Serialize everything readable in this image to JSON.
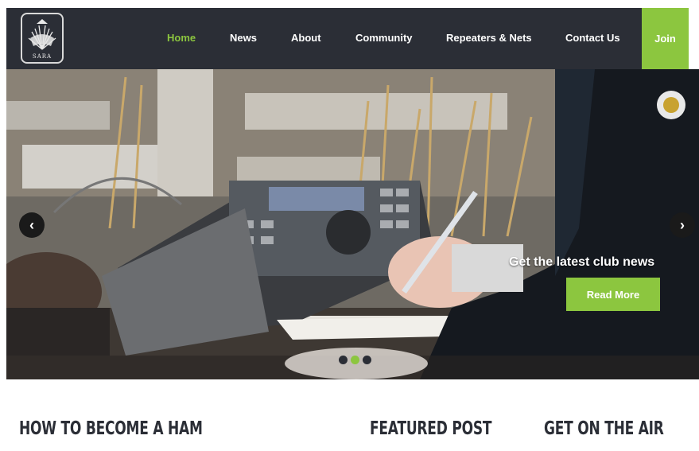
{
  "brand": {
    "logo_text": "SARA",
    "accent_color": "#8cc63f",
    "nav_bg": "#2b2e36"
  },
  "nav": {
    "items": [
      {
        "label": "Home",
        "active": true
      },
      {
        "label": "News",
        "active": false
      },
      {
        "label": "About",
        "active": false
      },
      {
        "label": "Community",
        "active": false
      },
      {
        "label": "Repeaters & Nets",
        "active": false
      },
      {
        "label": "Contact Us",
        "active": false
      }
    ],
    "join_label": "Join"
  },
  "hero": {
    "caption": "Get the latest club news",
    "button_label": "Read More",
    "prev_icon": "chevron-left-icon",
    "next_icon": "chevron-right-icon",
    "slides": 3,
    "active_slide": 2
  },
  "sections": {
    "become_ham": "HOW TO BECOME A HAM",
    "featured_post": "FEATURED POST",
    "get_on_air": "GET ON THE AIR"
  }
}
